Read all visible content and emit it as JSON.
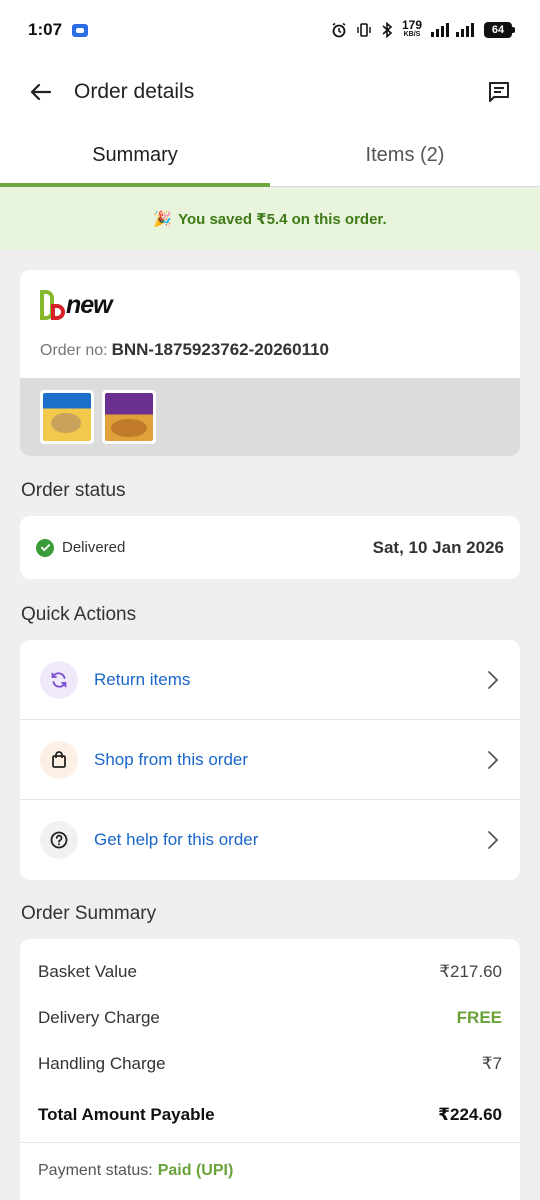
{
  "status_bar": {
    "time": "1:07",
    "net_speed": "179",
    "net_unit": "KB/S",
    "battery": "64"
  },
  "header": {
    "title": "Order details"
  },
  "tabs": [
    {
      "label": "Summary",
      "active": true
    },
    {
      "label": "Items (2)",
      "active": false
    }
  ],
  "savings": {
    "emoji": "🎉",
    "text": "You saved ₹5.4 on this order."
  },
  "order": {
    "brand": "new",
    "order_no_label": "Order no:",
    "order_no": "BNN-1875923762-20260110"
  },
  "order_status": {
    "title": "Order status",
    "status": "Delivered",
    "date": "Sat, 10 Jan 2026"
  },
  "quick_actions": {
    "title": "Quick Actions",
    "items": [
      {
        "label": "Return items",
        "icon": "refresh-icon"
      },
      {
        "label": "Shop from this order",
        "icon": "shopping-bag-icon"
      },
      {
        "label": "Get help for this order",
        "icon": "help-icon"
      }
    ]
  },
  "order_summary": {
    "title": "Order Summary",
    "rows": [
      {
        "label": "Basket Value",
        "value": "₹217.60"
      },
      {
        "label": "Delivery Charge",
        "value": "FREE"
      },
      {
        "label": "Handling Charge",
        "value": "₹7"
      }
    ],
    "total_label": "Total Amount Payable",
    "total_value": "₹224.60",
    "payment_label": "Payment status:",
    "payment_value": "Paid (UPI)"
  },
  "colors": {
    "accent_green": "#6ea73d",
    "link_blue": "#1a66c9",
    "savings_bg": "#e8f4dc"
  }
}
